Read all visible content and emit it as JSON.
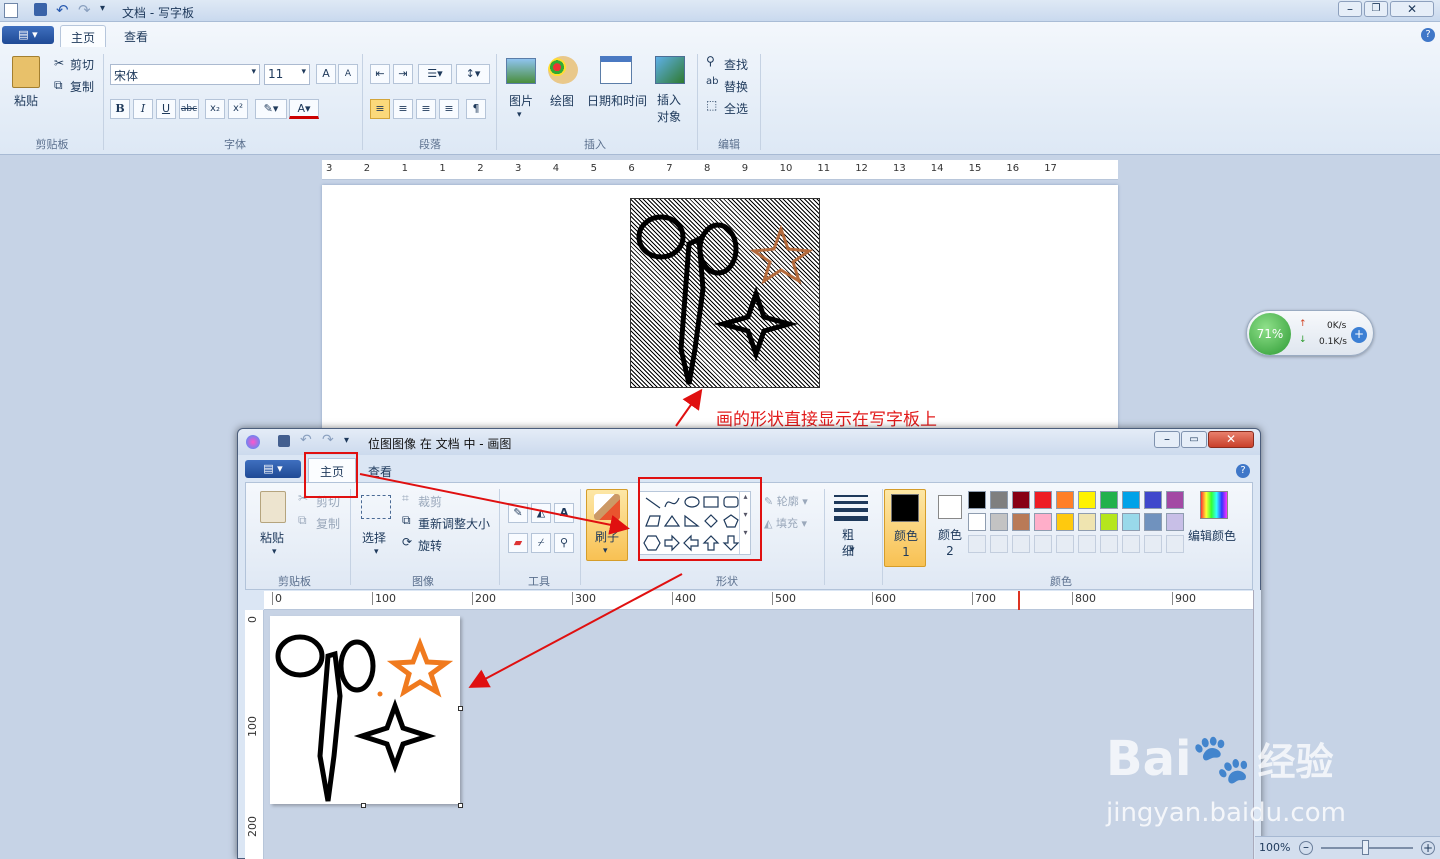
{
  "wordpad": {
    "title": "文档 - 写字板",
    "tabs": [
      "主页",
      "查看"
    ],
    "clipboard": {
      "paste": "粘贴",
      "cut": "剪切",
      "copy": "复制",
      "group": "剪贴板"
    },
    "font": {
      "name": "宋体",
      "size": "11",
      "group": "字体"
    },
    "paragraph_group": "段落",
    "insert": {
      "picture": "图片",
      "paint": "绘图",
      "datetime": "日期和时间",
      "object": "插入对象",
      "group": "插入"
    },
    "edit": {
      "find": "查找",
      "replace": "替换",
      "select_all": "全选",
      "group": "编辑"
    },
    "ruler": [
      "3",
      "2",
      "1",
      "1",
      "2",
      "3",
      "4",
      "5",
      "6",
      "7",
      "8",
      "9",
      "10",
      "11",
      "12",
      "13",
      "14",
      "15",
      "16",
      "17"
    ],
    "zoom": "100%"
  },
  "annotation": "画的形状直接显示在写字板上",
  "net_widget": {
    "percent": "71%",
    "up": "0K/s",
    "down": "0.1K/s"
  },
  "paint": {
    "title": "位图图像 在 文档 中 - 画图",
    "tabs": [
      "主页",
      "查看"
    ],
    "clipboard": {
      "paste": "粘贴",
      "cut": "剪切",
      "copy": "复制",
      "group": "剪贴板"
    },
    "image": {
      "select": "选择",
      "crop": "裁剪",
      "resize": "重新调整大小",
      "rotate": "旋转",
      "group": "图像"
    },
    "tools_group": "工具",
    "brush": "刷子",
    "shapes": {
      "outline": "轮廓",
      "fill": "填充",
      "group": "形状"
    },
    "size": "粗细",
    "color1": "颜色 1",
    "color2": "颜色 2",
    "edit_colors": "编辑颜色",
    "colors_group": "颜色",
    "hruler": [
      "0",
      "100",
      "200",
      "300",
      "400",
      "500",
      "600",
      "700",
      "800",
      "900"
    ],
    "vruler": [
      "0",
      "100",
      "200"
    ],
    "palette": [
      "#000000",
      "#7f7f7f",
      "#880015",
      "#ed1c24",
      "#ff7f27",
      "#fff200",
      "#22b14c",
      "#00a2e8",
      "#3f48cc",
      "#a349a4",
      "#ffffff",
      "#c3c3c3",
      "#b97a57",
      "#ffaec9",
      "#ffc90e",
      "#efe4b0",
      "#b5e61d",
      "#99d9ea",
      "#7092be",
      "#c8bfe7"
    ]
  },
  "watermark": {
    "brand": "Bai",
    "brand2": "经验",
    "url": "jingyan.baidu.com"
  }
}
